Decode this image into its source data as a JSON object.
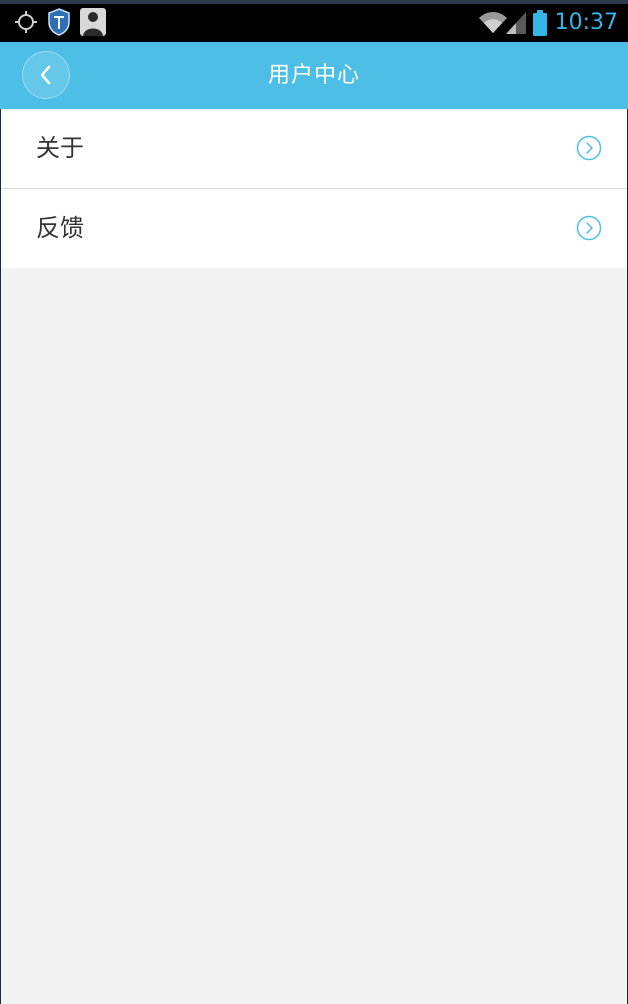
{
  "status_bar": {
    "time": "10:37",
    "icons": [
      "gps-icon",
      "shield-icon",
      "avatar-icon",
      "wifi-icon",
      "signal-icon",
      "battery-icon"
    ],
    "accent": "#33b5e5"
  },
  "header": {
    "title": "用户中心",
    "back_icon": "chevron-left-icon",
    "background": "#4dbfe6"
  },
  "menu": {
    "items": [
      {
        "label": "关于",
        "icon": "chevron-right-circle-icon"
      },
      {
        "label": "反馈",
        "icon": "chevron-right-circle-icon"
      }
    ]
  }
}
